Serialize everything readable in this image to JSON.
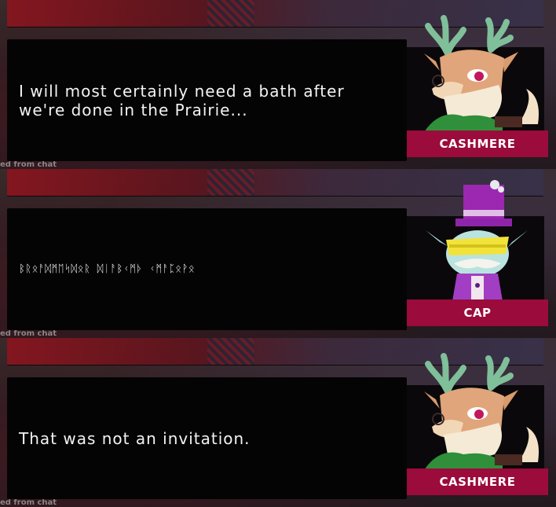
{
  "dialogs": [
    {
      "text": "I will most certainly need a bath after we're done in the Prairie...",
      "speaker": "CASHMERE",
      "chat_label": "ed from chat",
      "portrait": "cashmere-deer-portrait"
    },
    {
      "text": "ᛒᚱᛟᚨᛞᛗᛖᛋᛞᛟᚱ ᛞᛁᚨᛒᚲᛗᚦ ᚲᛗᚨᛈᛟᚹᛟ",
      "speaker": "CAP",
      "chat_label": "ed from chat",
      "portrait": "cap-tophat-portrait"
    },
    {
      "text": "That was not an invitation.",
      "speaker": "CASHMERE",
      "chat_label": "ed from chat",
      "portrait": "cashmere-deer-portrait"
    }
  ],
  "colors": {
    "name_plate": "#9b0b3b",
    "dialog_bg": "#050405",
    "text": "#f4f2f2"
  }
}
